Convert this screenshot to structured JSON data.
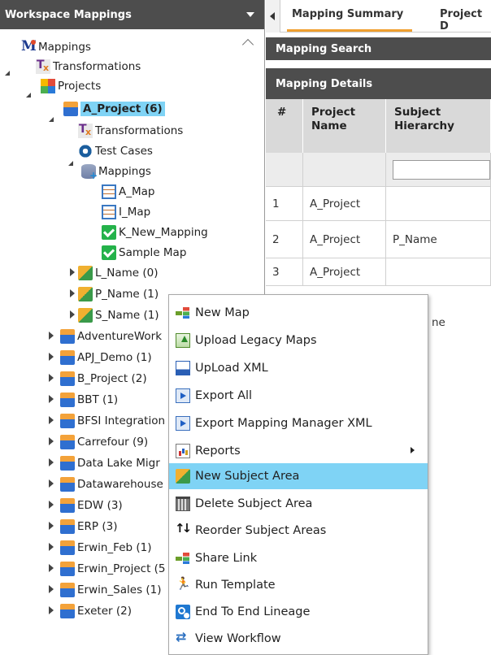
{
  "left_panel": {
    "title": "Workspace Mappings",
    "tree": {
      "mappings_root": "Mappings",
      "transformations": "Transformations",
      "projects": "Projects",
      "a_project": "A_Project (6)",
      "a_transformations": "Transformations",
      "a_test_cases": "Test Cases",
      "a_mappings": "Mappings",
      "maps": [
        "A_Map",
        "I_Map",
        "K_New_Mapping",
        "Sample Map"
      ],
      "subject_areas": [
        "L_Name (0)",
        "P_Name (1)",
        "S_Name (1)"
      ],
      "other_projects": [
        "AdventureWork",
        "APJ_Demo (1)",
        "B_Project (2)",
        "BBT (1)",
        "BFSI Integration",
        "Carrefour (9)",
        "Data Lake Migr",
        "Datawarehouse",
        "EDW (3)",
        "ERP (3)",
        "Erwin_Feb (1)",
        "Erwin_Project (5",
        "Erwin_Sales (1)",
        "Exeter (2)"
      ]
    }
  },
  "right_panel": {
    "tabs": [
      "Mapping Summary",
      "Project D"
    ],
    "sections": {
      "search": "Mapping Search",
      "details": "Mapping Details"
    },
    "grid": {
      "headers": [
        "#",
        "Project Name",
        "Subject Hierarchy"
      ],
      "rows": [
        {
          "num": "1",
          "project": "A_Project",
          "subject": ""
        },
        {
          "num": "2",
          "project": "A_Project",
          "subject": "P_Name"
        },
        {
          "num": "3",
          "project": "A_Project",
          "subject": ""
        },
        {
          "num": "",
          "project": "",
          "subject": "ne"
        }
      ]
    }
  },
  "context_menu": {
    "items": [
      {
        "label": "New Map",
        "icon": "new-map-icon"
      },
      {
        "label": "Upload Legacy Maps",
        "icon": "upload-icon"
      },
      {
        "label": "UpLoad XML",
        "icon": "xml-icon"
      },
      {
        "label": "Export All",
        "icon": "export-icon"
      },
      {
        "label": "Export Mapping Manager XML",
        "icon": "export-icon"
      },
      {
        "label": "Reports",
        "icon": "reports-icon",
        "has_submenu": true
      },
      {
        "label": "New Subject Area",
        "icon": "subject-area-icon",
        "highlighted": true
      },
      {
        "label": "Delete Subject Area",
        "icon": "trash-icon"
      },
      {
        "label": "Reorder Subject Areas",
        "icon": "reorder-icon"
      },
      {
        "label": "Share Link",
        "icon": "share-link-icon"
      },
      {
        "label": "Run Template",
        "icon": "run-icon"
      },
      {
        "label": "End To End Lineage",
        "icon": "lineage-icon"
      },
      {
        "label": "View Workflow",
        "icon": "workflow-icon"
      }
    ]
  },
  "colors": {
    "header_bg": "#4d4d4d",
    "selection": "#7fd3f5",
    "tab_accent": "#f0a030",
    "grid_header": "#d9d9d9"
  }
}
